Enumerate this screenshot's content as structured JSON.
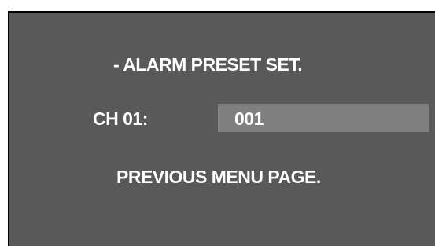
{
  "menu": {
    "title": "- ALARM PRESET SET.",
    "channel_label": "CH 01:",
    "channel_value": "001",
    "previous_page": "PREVIOUS MENU PAGE."
  },
  "colors": {
    "screen_background": "#595959",
    "selected_field": "#7f7f7f",
    "text": "#ffffff"
  }
}
